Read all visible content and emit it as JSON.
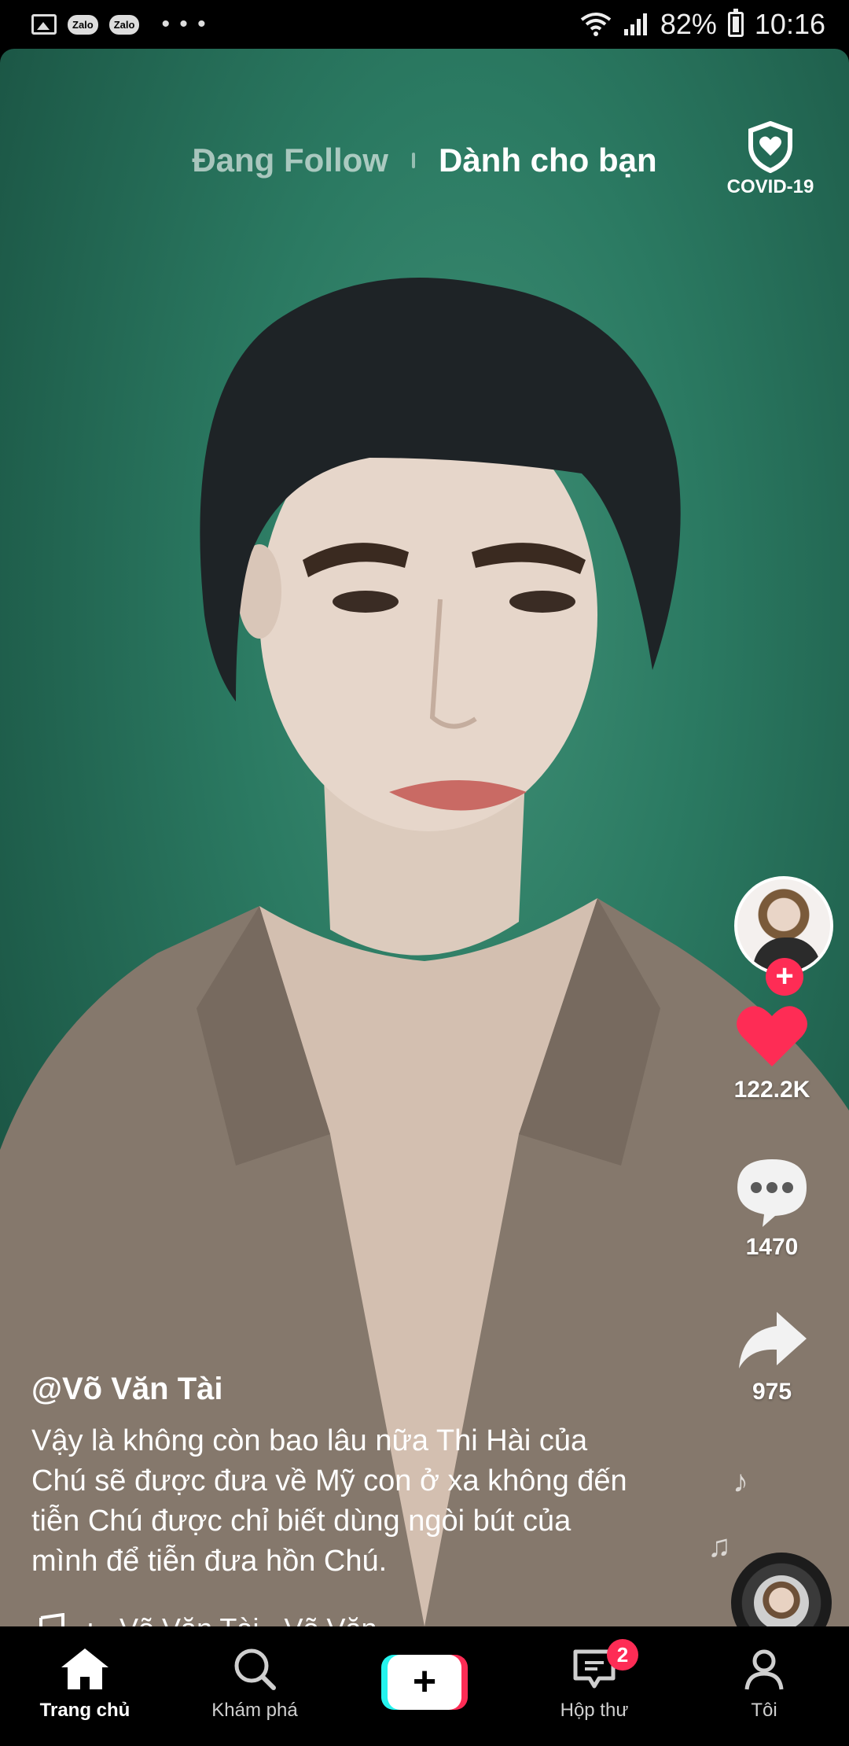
{
  "status_bar": {
    "left_icons": [
      "gallery-icon",
      "zalo-icon",
      "zalo-icon",
      "more-dots-icon"
    ],
    "zalo_label_1": "Zalo",
    "zalo_label_2": "Zalo",
    "dots": "• • •",
    "battery_percent": "82%",
    "time": "10:16"
  },
  "top_tabs": {
    "following_label": "Đang Follow",
    "for_you_label": "Dành cho bạn",
    "active": "for_you"
  },
  "covid": {
    "label": "COVID-19",
    "icon": "shield-heart-icon"
  },
  "rail": {
    "follow_symbol": "+",
    "likes": "122.2K",
    "comments": "1470",
    "shares": "975"
  },
  "post": {
    "username": "@Võ Văn Tài",
    "description": "Vậy là không còn bao lâu nữa Thi Hài của Chú sẽ được đưa về Mỹ con ở xa không đến tiễn Chú được chỉ biết dùng ngòi bút của mình để tiễn đưa hồn Chú.",
    "sound": "ı - Võ Văn Tài - Võ Văn"
  },
  "bottom_nav": {
    "items": [
      {
        "label": "Trang chủ",
        "icon": "home-icon",
        "active": true
      },
      {
        "label": "Khám phá",
        "icon": "search-icon",
        "active": false
      },
      {
        "label": "+",
        "icon": "create-icon",
        "active": false
      },
      {
        "label": "Hộp thư",
        "icon": "inbox-icon",
        "active": false
      },
      {
        "label": "Tôi",
        "icon": "profile-icon",
        "active": false
      }
    ],
    "inbox_badge": "2"
  },
  "colors": {
    "accent_red": "#fe2c55",
    "accent_cyan": "#25f4ee",
    "background_green": "#2b7a62"
  }
}
